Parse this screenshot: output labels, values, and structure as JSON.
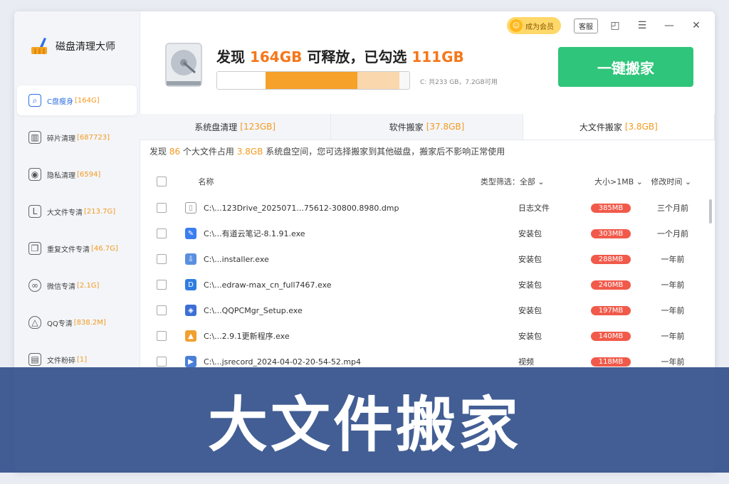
{
  "app": {
    "title": "磁盘清理大师"
  },
  "titlebar": {
    "vip_label": "成为会员",
    "service_label": "客服"
  },
  "sidebar": {
    "items": [
      {
        "label": "C盘瘦身",
        "count": "[164G]",
        "icon": "disk-search-icon"
      },
      {
        "label": "碎片清理",
        "count": "[687723]",
        "icon": "bar-chart-icon"
      },
      {
        "label": "隐私清理",
        "count": "[6594]",
        "icon": "privacy-icon"
      },
      {
        "label": "大文件专清",
        "count": "[213.7G]",
        "icon": "large-file-icon"
      },
      {
        "label": "重复文件专清",
        "count": "[46.7G]",
        "icon": "duplicate-file-icon"
      },
      {
        "label": "微信专清",
        "count": "[2.1G]",
        "icon": "wechat-icon"
      },
      {
        "label": "QQ专清",
        "count": "[838.2M]",
        "icon": "qq-icon"
      },
      {
        "label": "文件粉碎",
        "count": "[1]",
        "icon": "shredder-icon"
      }
    ]
  },
  "summary": {
    "prefix": "发现 ",
    "found": "164GB",
    "middle": " 可释放，已勾选 ",
    "selected": "111GB",
    "disk_note": "C: 共233 GB，7.2GB可用",
    "bar": {
      "used_fraction": 0.25,
      "releasable_fraction": 0.48,
      "selected_fraction": 0.22
    }
  },
  "move_button": "一键搬家",
  "tabs": [
    {
      "label": "系统盘清理",
      "count": "[123GB]"
    },
    {
      "label": "软件搬家",
      "count": "[37.8GB]"
    },
    {
      "label": "大文件搬家",
      "count": "[3.8GB]"
    }
  ],
  "info": {
    "p1": "发现 ",
    "n": "86",
    "p2": " 个大文件占用 ",
    "size": "3.8GB",
    "p3": " 系统盘空间，您可选择搬家到其他磁盘，搬家后不影响正常使用"
  },
  "table": {
    "headers": {
      "name": "名称",
      "type": "类型筛选：全部 ⌄",
      "size": "大小>1MB ⌄",
      "time": "修改时间 ⌄"
    },
    "rows": [
      {
        "name": "C:\\...123Drive_2025071...75612-30800.8980.dmp",
        "type": "日志文件",
        "size": "385MB",
        "time": "三个月前",
        "icon": "file-icon",
        "color": "#ffffff"
      },
      {
        "name": "C:\\...有道云笔记-8.1.91.exe",
        "type": "安装包",
        "size": "303MB",
        "time": "一个月前",
        "icon": "youdao-note-icon",
        "color": "#3a7ef0"
      },
      {
        "name": "C:\\...installer.exe",
        "type": "安装包",
        "size": "288MB",
        "time": "一年前",
        "icon": "installer-icon",
        "color": "#5a8fe0"
      },
      {
        "name": "C:\\...edraw-max_cn_full7467.exe",
        "type": "安装包",
        "size": "240MB",
        "time": "一年前",
        "icon": "edraw-icon",
        "color": "#2f7de1"
      },
      {
        "name": "C:\\...QQPCMgr_Setup.exe",
        "type": "安装包",
        "size": "197MB",
        "time": "一年前",
        "icon": "qqpcmgr-icon",
        "color": "#3c6fd6"
      },
      {
        "name": "C:\\...2.9.1更新程序.exe",
        "type": "安装包",
        "size": "140MB",
        "time": "一年前",
        "icon": "updater-icon",
        "color": "#f0a030"
      },
      {
        "name": "C:\\...jsrecord_2024-04-02-20-54-52.mp4",
        "type": "视频",
        "size": "118MB",
        "time": "一年前",
        "icon": "video-file-icon",
        "color": "#4a7fd8"
      }
    ]
  },
  "banner": {
    "text": "大文件搬家"
  }
}
